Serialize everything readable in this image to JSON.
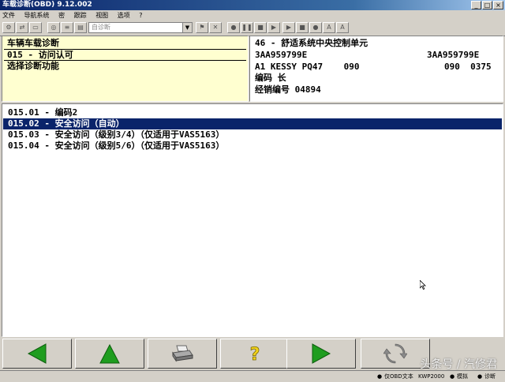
{
  "window": {
    "title": "车载诊断(OBD) 9.12.002"
  },
  "menu": [
    "文件",
    "导航系统",
    "密",
    "跟踪",
    "视图",
    "选项",
    "?"
  ],
  "toolbar": {
    "dropdown_value": "自诊断"
  },
  "left_panel": {
    "lines": [
      "车辆车载诊断",
      "015 - 访问认可",
      "选择诊断功能"
    ]
  },
  "right_panel": {
    "line1": "46 - 舒适系统中央控制单元",
    "line2_left": "3AA959799E",
    "line2_right": "3AA959799E",
    "line3_left": "A1 KESSY PQ47    090",
    "line3_right": "090  0375",
    "line4": "编码 长",
    "line5": "经销编号 04894"
  },
  "list": {
    "items": [
      "015.01 - 编码2",
      "015.02 - 安全访问（自动）",
      "015.03 - 安全访问（级别3/4）（仅适用于VAS5163）",
      "015.04 - 安全访问（级别5/6）（仅适用于VAS5163）"
    ],
    "selected_index": 1
  },
  "bottom_buttons": {
    "back": "back-arrow-icon",
    "up": "up-arrow-icon",
    "print": "printer-icon",
    "help": "question-icon",
    "forward": "forward-arrow-icon",
    "refresh": "refresh-icon"
  },
  "statusbar": {
    "item1": "仅OBD文本",
    "item2": "KWP2000",
    "item3": "模拟",
    "item4": "诊断"
  },
  "watermark": "头条号 / 汽修君",
  "colors": {
    "selection": "#0a246a",
    "arrow_green": "#1f9d1f",
    "panel_yellow": "#ffffd0"
  }
}
